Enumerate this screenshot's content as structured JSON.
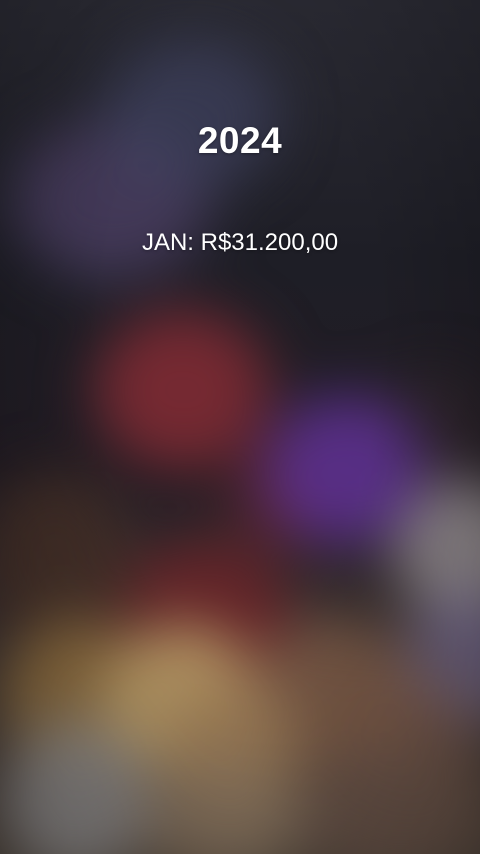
{
  "headline": {
    "year": "2024"
  },
  "entry": {
    "text": "JAN: R$31.200,00"
  },
  "background": {
    "style": "blurred bokeh lights",
    "colors": [
      "#7a2a33",
      "#5a2f8a",
      "#b59864",
      "#a9a3a6",
      "#4b3f63"
    ]
  }
}
